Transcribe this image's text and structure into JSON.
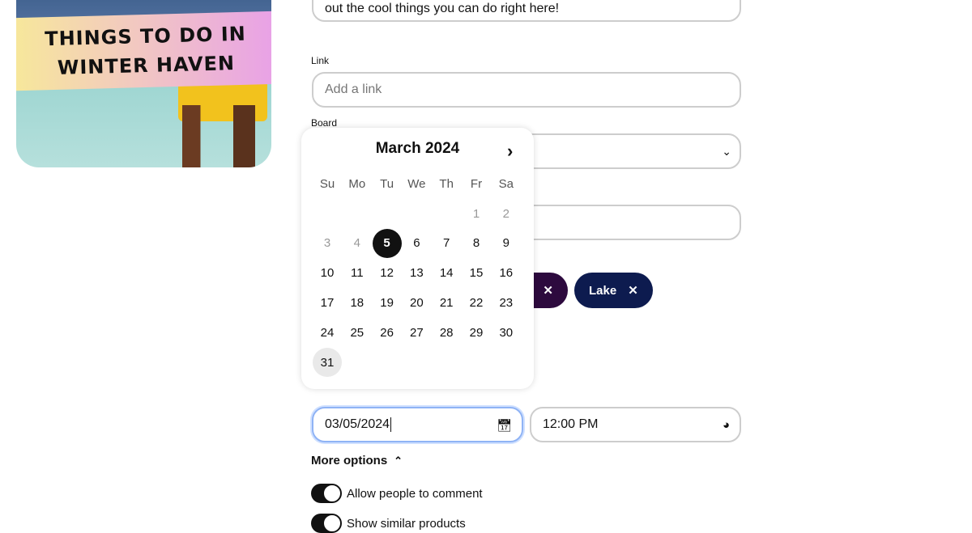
{
  "pin": {
    "banner_line1": "THINGS TO DO IN",
    "banner_line2": "WINTER HAVEN"
  },
  "description": {
    "value": "out the cool things you can do right here!"
  },
  "link": {
    "label": "Link",
    "placeholder": "Add a link"
  },
  "board": {
    "label": "Board"
  },
  "tags": [
    {
      "label": "",
      "color": "#2d0a3e"
    },
    {
      "label": "Lake",
      "color": "#0d1b4f"
    }
  ],
  "calendar": {
    "title": "March 2024",
    "weekdays": [
      "Su",
      "Mo",
      "Tu",
      "We",
      "Th",
      "Fr",
      "Sa"
    ],
    "selected_day": 5,
    "today_day": 31,
    "days_in_month": 31,
    "first_weekday": 5
  },
  "schedule": {
    "date": "03/05/2024",
    "time": "12:00 PM"
  },
  "more_options": {
    "label": "More options"
  },
  "toggles": [
    {
      "label": "Allow people to comment",
      "on": true
    },
    {
      "label": "Show similar products",
      "on": true
    }
  ]
}
